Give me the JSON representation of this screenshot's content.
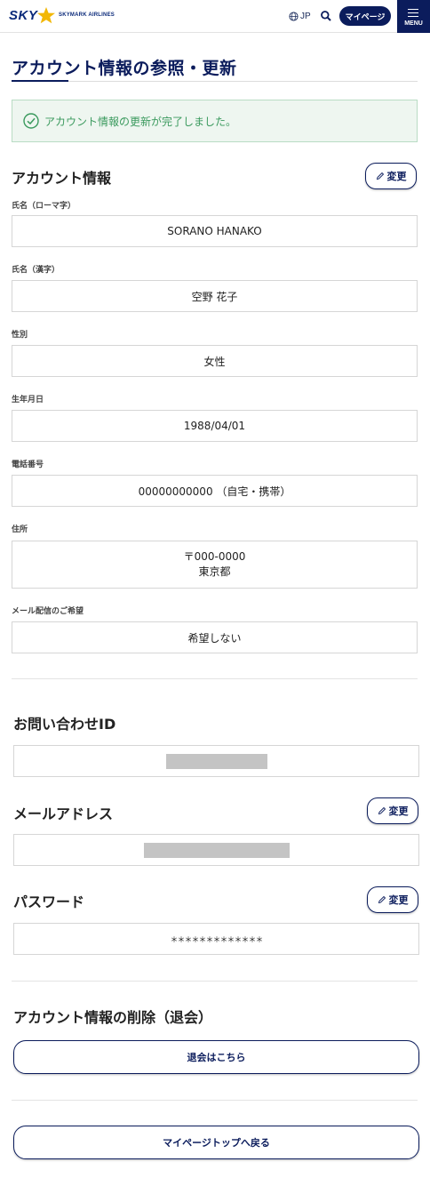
{
  "header": {
    "logo_text": "SKY",
    "logo_subtext": "SKYMARK AIRLINES",
    "language": "JP",
    "mypage_label": "マイページ",
    "menu_label": "MENU"
  },
  "page": {
    "title": "アカウント情報の参照・更新",
    "success_message": "アカウント情報の更新が完了しました。"
  },
  "account": {
    "heading": "アカウント情報",
    "edit_label": "変更",
    "fields": [
      {
        "label": "氏名（ローマ字）",
        "value": "SORANO HANAKO"
      },
      {
        "label": "氏名（漢字）",
        "value": "空野 花子"
      },
      {
        "label": "性別",
        "value": "女性"
      },
      {
        "label": "生年月日",
        "value": "1988/04/01"
      },
      {
        "label": "電話番号",
        "value": "00000000000 （自宅・携帯）"
      },
      {
        "label": "住所",
        "value": "〒000-0000",
        "value2": "東京都"
      },
      {
        "label": "メール配信のご希望",
        "value": "希望しない"
      }
    ]
  },
  "inquiry": {
    "heading": "お問い合わせID"
  },
  "email": {
    "heading": "メールアドレス",
    "edit_label": "変更"
  },
  "password": {
    "heading": "パスワード",
    "edit_label": "変更",
    "value": "＊＊＊＊＊＊＊＊＊＊＊＊＊"
  },
  "delete": {
    "heading": "アカウント情報の削除（退会）",
    "button_label": "退会はこちら"
  },
  "footer": {
    "back_label": "マイページトップへ戻る"
  },
  "colors": {
    "brand_navy": "#0b1c5c",
    "success_green": "#3b9a5e",
    "logo_gold": "#f2b705"
  }
}
